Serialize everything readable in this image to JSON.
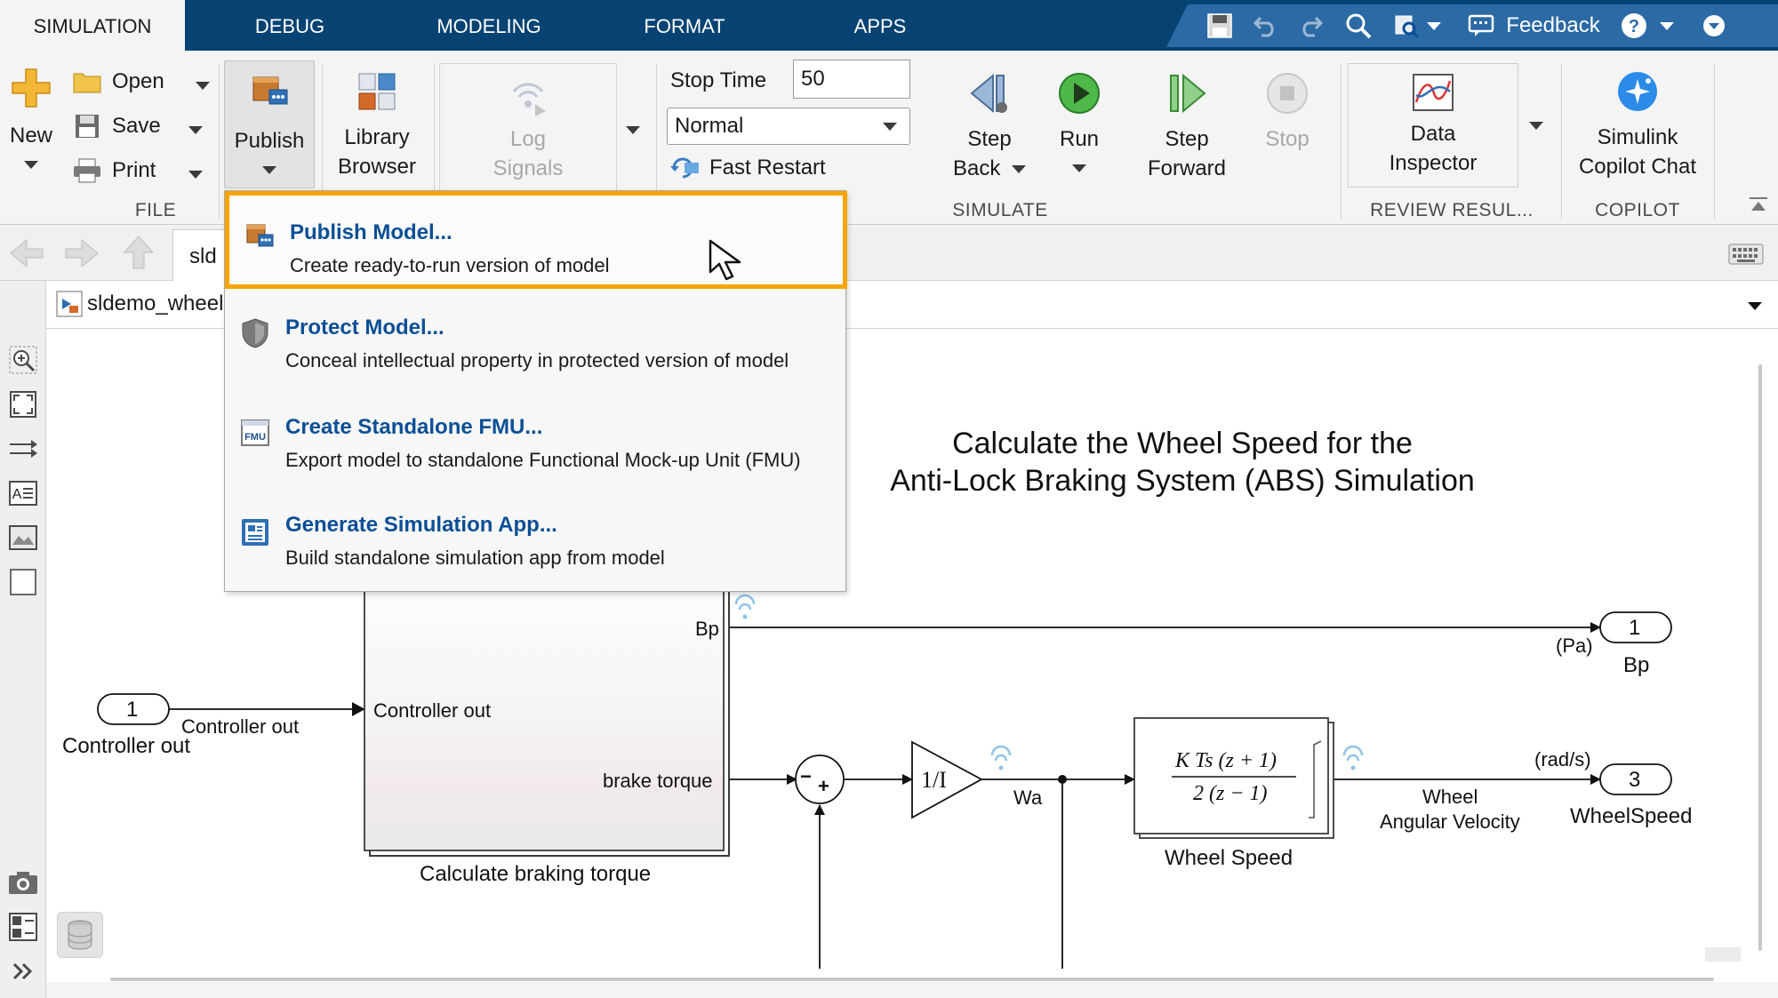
{
  "tabs": [
    {
      "label": "SIMULATION",
      "active": true
    },
    {
      "label": "DEBUG",
      "active": false
    },
    {
      "label": "MODELING",
      "active": false
    },
    {
      "label": "FORMAT",
      "active": false
    },
    {
      "label": "APPS",
      "active": false
    }
  ],
  "quick_access": {
    "feedback_label": "Feedback",
    "icons": [
      "save-icon",
      "undo-icon",
      "redo-icon",
      "search-icon",
      "find-icon",
      "chat-icon",
      "help-icon",
      "collapse-icon"
    ]
  },
  "toolstrip": {
    "file": {
      "section_label": "FILE",
      "new_label": "New",
      "open_label": "Open",
      "save_label": "Save",
      "print_label": "Print"
    },
    "publish_label": "Publish",
    "library_browser_label": [
      "Library",
      "Browser"
    ],
    "log_signals_label": [
      "Log",
      "Signals"
    ],
    "simulate": {
      "section_label": "SIMULATE",
      "stop_time_label": "Stop Time",
      "stop_time_value": "50",
      "mode_value": "Normal",
      "fast_restart_label": "Fast Restart",
      "step_back_label": [
        "Step",
        "Back"
      ],
      "run_label": "Run",
      "step_forward_label": [
        "Step",
        "Forward"
      ],
      "stop_label": "Stop"
    },
    "review": {
      "section_label": "REVIEW RESUL...",
      "data_inspector_label": [
        "Data",
        "Inspector"
      ]
    },
    "copilot": {
      "section_label": "COPILOT",
      "chat_label": [
        "Simulink",
        "Copilot Chat"
      ]
    }
  },
  "navigation": {
    "tab_label": "sld",
    "model_path": "sldemo_wheel"
  },
  "publish_menu": {
    "items": [
      {
        "title": "Publish Model...",
        "desc": "Create ready-to-run version of model",
        "icon": "publish-icon",
        "highlighted": true
      },
      {
        "title": "Protect Model...",
        "desc": "Conceal intellectual property in protected version of model",
        "icon": "shield-icon",
        "highlighted": false
      },
      {
        "title": "Create Standalone FMU...",
        "desc": "Export model to standalone Functional Mock-up Unit (FMU)",
        "icon": "fmu-icon",
        "highlighted": false
      },
      {
        "title": "Generate Simulation App...",
        "desc": "Build standalone simulation app from model",
        "icon": "app-icon",
        "highlighted": false
      }
    ]
  },
  "diagram": {
    "title_line1": "Calculate the Wheel Speed for the",
    "title_line2": "Anti-Lock Braking System (ABS) Simulation",
    "inport_1_number": "1",
    "inport_1_name": "Controller out",
    "inport_1_signal": "Controller out",
    "subsystem_in_port": "Controller out",
    "subsystem_bp_port": "Bp",
    "subsystem_torque_port": "brake torque",
    "subsystem_name": "Calculate braking torque",
    "outport_1_number": "1",
    "outport_1_name": "Bp",
    "outport_1_unit": "(Pa)",
    "gain_label": "1/I",
    "wa_label": "Wa",
    "tf_numerator": "K Ts (z + 1)",
    "tf_denominator": "2 (z − 1)",
    "tf_name": "Wheel Speed",
    "wheel_signal_line1": "Wheel",
    "wheel_signal_line2": "Angular Velocity",
    "outport_3_number": "3",
    "outport_3_name": "WheelSpeed",
    "outport_3_unit": "(rad/s)",
    "sum_minus": "−",
    "sum_plus": "+"
  }
}
